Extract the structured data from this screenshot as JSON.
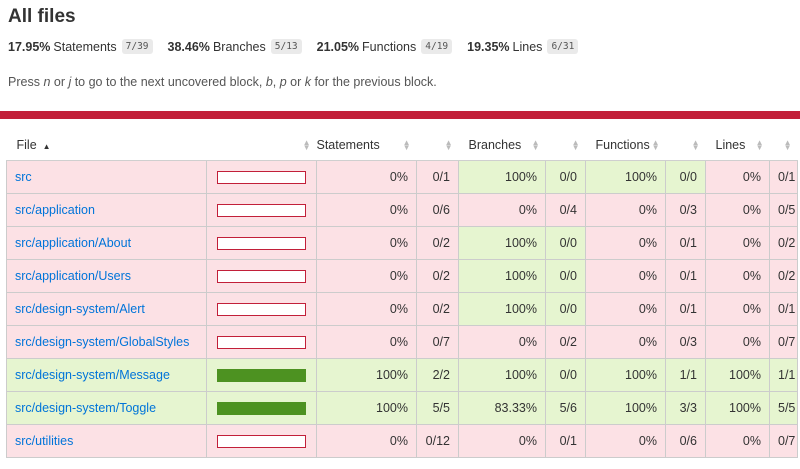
{
  "header": {
    "title": "All files",
    "summary": [
      {
        "pct": "17.95%",
        "label": "Statements",
        "fraction": "7/39"
      },
      {
        "pct": "38.46%",
        "label": "Branches",
        "fraction": "5/13"
      },
      {
        "pct": "21.05%",
        "label": "Functions",
        "fraction": "4/19"
      },
      {
        "pct": "19.35%",
        "label": "Lines",
        "fraction": "6/31"
      }
    ],
    "hint_parts": [
      "Press ",
      "n",
      " or ",
      "j",
      " to go to the next uncovered block, ",
      "b",
      ", ",
      "p",
      " or ",
      "k",
      " for the previous block."
    ]
  },
  "colors": {
    "low": "#fce1e5",
    "high": "#e6f5d0",
    "bar_low": "#c21f39",
    "bar_high": "#4d9221",
    "link": "#0074d9"
  },
  "table": {
    "columns": [
      "File",
      "Statements",
      "Branches",
      "Functions",
      "Lines"
    ],
    "rows": [
      {
        "file": "src",
        "coverage": 0,
        "status": "low",
        "stmt_pct": "0%",
        "stmt_frac": "0/1",
        "br_pct": "100%",
        "br_frac": "0/0",
        "br_status": "high",
        "fn_pct": "100%",
        "fn_frac": "0/0",
        "fn_status": "high",
        "ln_pct": "0%",
        "ln_frac": "0/1"
      },
      {
        "file": "src/application",
        "coverage": 0,
        "status": "low",
        "stmt_pct": "0%",
        "stmt_frac": "0/6",
        "br_pct": "0%",
        "br_frac": "0/4",
        "br_status": "low",
        "fn_pct": "0%",
        "fn_frac": "0/3",
        "fn_status": "low",
        "ln_pct": "0%",
        "ln_frac": "0/5"
      },
      {
        "file": "src/application/About",
        "coverage": 0,
        "status": "low",
        "stmt_pct": "0%",
        "stmt_frac": "0/2",
        "br_pct": "100%",
        "br_frac": "0/0",
        "br_status": "high",
        "fn_pct": "0%",
        "fn_frac": "0/1",
        "fn_status": "low",
        "ln_pct": "0%",
        "ln_frac": "0/2"
      },
      {
        "file": "src/application/Users",
        "coverage": 0,
        "status": "low",
        "stmt_pct": "0%",
        "stmt_frac": "0/2",
        "br_pct": "100%",
        "br_frac": "0/0",
        "br_status": "high",
        "fn_pct": "0%",
        "fn_frac": "0/1",
        "fn_status": "low",
        "ln_pct": "0%",
        "ln_frac": "0/2"
      },
      {
        "file": "src/design-system/Alert",
        "coverage": 0,
        "status": "low",
        "stmt_pct": "0%",
        "stmt_frac": "0/2",
        "br_pct": "100%",
        "br_frac": "0/0",
        "br_status": "high",
        "fn_pct": "0%",
        "fn_frac": "0/1",
        "fn_status": "low",
        "ln_pct": "0%",
        "ln_frac": "0/1"
      },
      {
        "file": "src/design-system/GlobalStyles",
        "coverage": 0,
        "status": "low",
        "stmt_pct": "0%",
        "stmt_frac": "0/7",
        "br_pct": "0%",
        "br_frac": "0/2",
        "br_status": "low",
        "fn_pct": "0%",
        "fn_frac": "0/3",
        "fn_status": "low",
        "ln_pct": "0%",
        "ln_frac": "0/7"
      },
      {
        "file": "src/design-system/Message",
        "coverage": 100,
        "status": "high",
        "stmt_pct": "100%",
        "stmt_frac": "2/2",
        "br_pct": "100%",
        "br_frac": "0/0",
        "br_status": "high",
        "fn_pct": "100%",
        "fn_frac": "1/1",
        "fn_status": "high",
        "ln_pct": "100%",
        "ln_frac": "1/1"
      },
      {
        "file": "src/design-system/Toggle",
        "coverage": 100,
        "status": "high",
        "stmt_pct": "100%",
        "stmt_frac": "5/5",
        "br_pct": "83.33%",
        "br_frac": "5/6",
        "br_status": "high",
        "fn_pct": "100%",
        "fn_frac": "3/3",
        "fn_status": "high",
        "ln_pct": "100%",
        "ln_frac": "5/5"
      },
      {
        "file": "src/utilities",
        "coverage": 0,
        "status": "low",
        "stmt_pct": "0%",
        "stmt_frac": "0/12",
        "br_pct": "0%",
        "br_frac": "0/1",
        "br_status": "low",
        "fn_pct": "0%",
        "fn_frac": "0/6",
        "fn_status": "low",
        "ln_pct": "0%",
        "ln_frac": "0/7"
      }
    ]
  }
}
